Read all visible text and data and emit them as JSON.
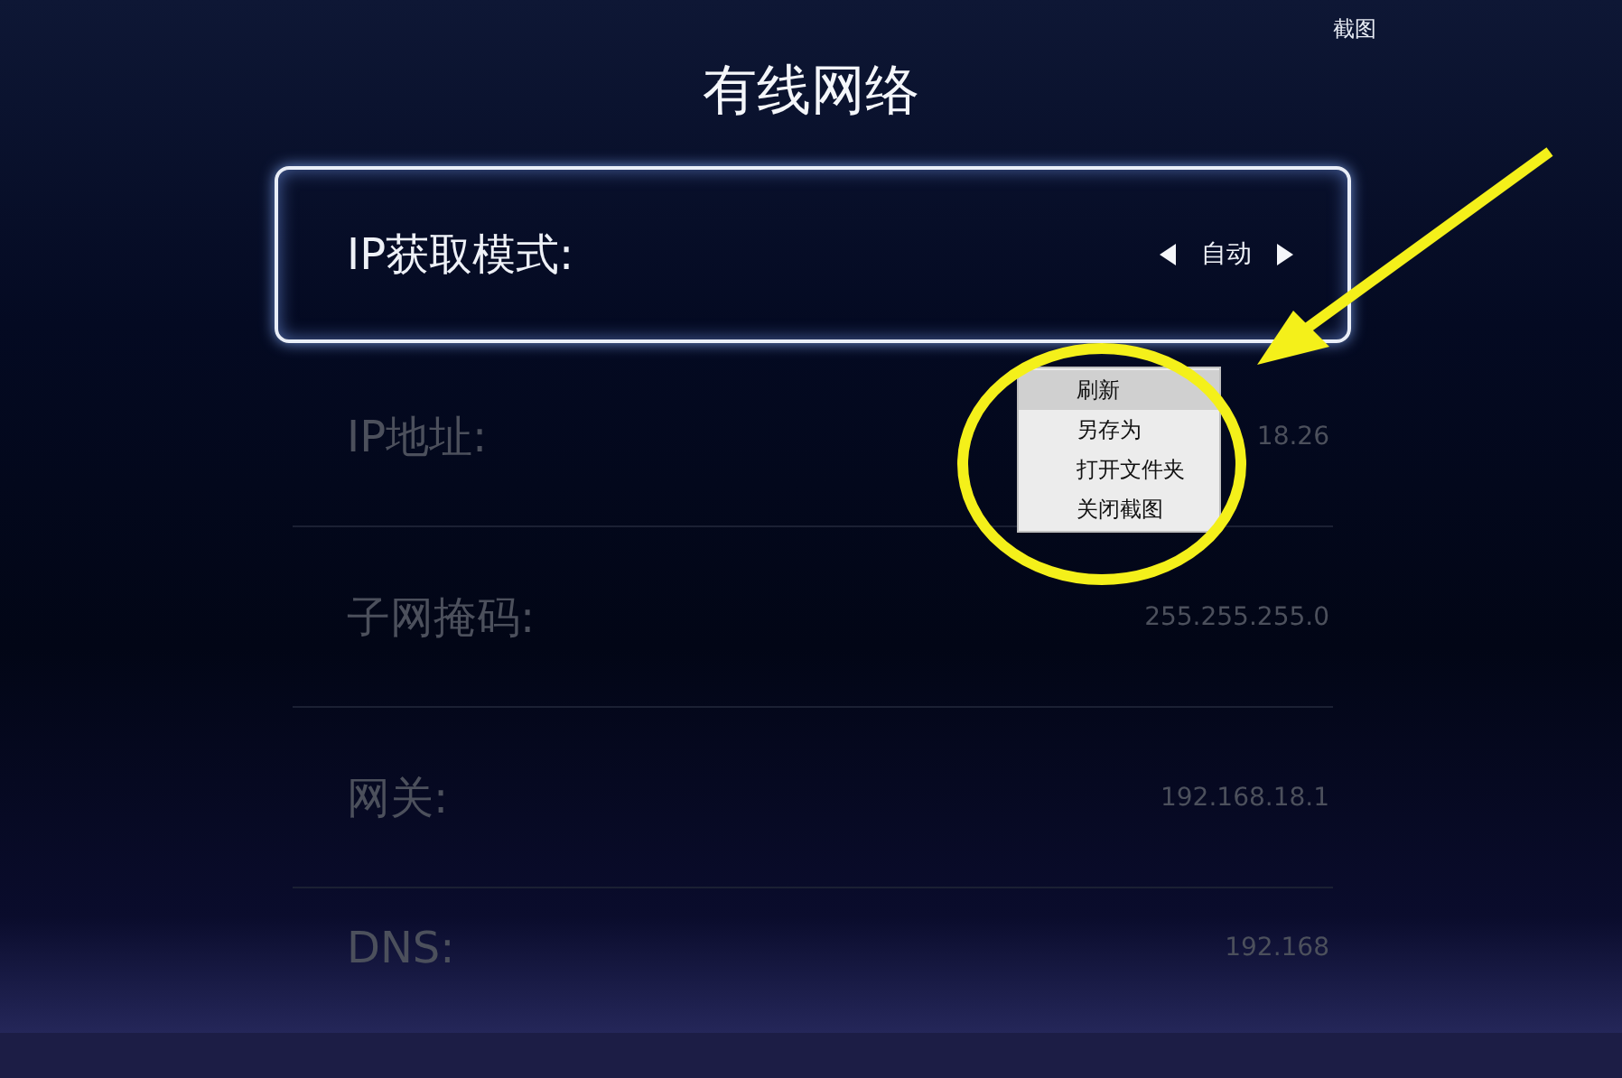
{
  "header": {
    "title": "有线网络",
    "screenshot_label": "截图"
  },
  "settings": [
    {
      "kind": "selector",
      "label": "IP获取模式:",
      "value": "自动",
      "focused": true
    },
    {
      "kind": "text",
      "label": "IP地址:",
      "value": "18.26",
      "focused": false
    },
    {
      "kind": "text",
      "label": "子网掩码:",
      "value": "255.255.255.0",
      "focused": false
    },
    {
      "kind": "text",
      "label": "网关:",
      "value": "192.168.18.1",
      "focused": false
    },
    {
      "kind": "text",
      "label": "DNS:",
      "value": "192.168",
      "focused": false
    }
  ],
  "context_menu": {
    "items": [
      {
        "label": "刷新",
        "selected": true
      },
      {
        "label": "另存为",
        "selected": false
      },
      {
        "label": "打开文件夹",
        "selected": false
      },
      {
        "label": "关闭截图",
        "selected": false
      }
    ]
  }
}
